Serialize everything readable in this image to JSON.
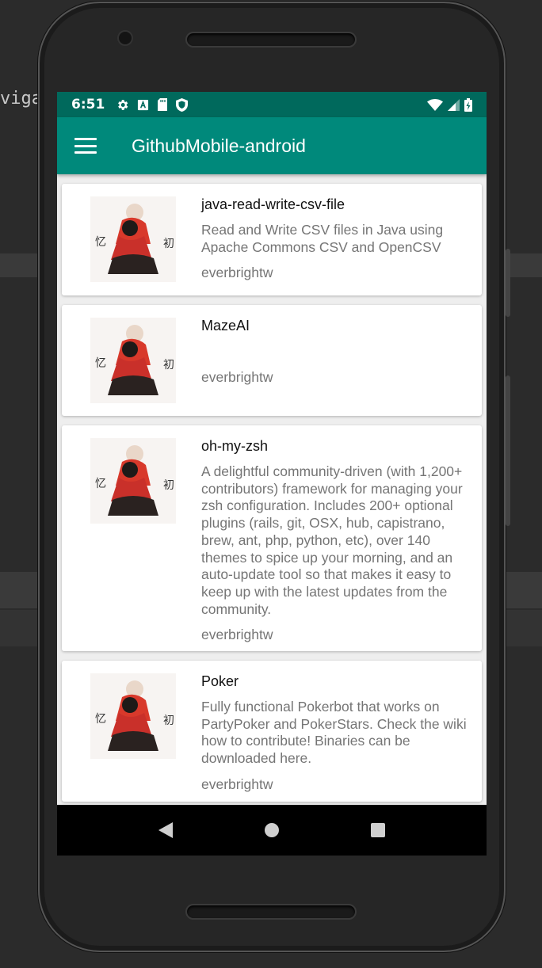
{
  "background": {
    "ide_text": "viga"
  },
  "status_bar": {
    "time": "6:51",
    "icons_left": [
      "settings-icon",
      "a-icon",
      "sd-card-icon",
      "shield-icon"
    ],
    "icons_right": [
      "wifi-icon",
      "signal-icon",
      "battery-charging-icon"
    ],
    "color": "#00695c"
  },
  "app_bar": {
    "title": "GithubMobile-android",
    "menu_icon": "hamburger-menu-icon",
    "color": "#00897b"
  },
  "repos": [
    {
      "name": "java-read-write-csv-file",
      "description": "Read and Write CSV files in Java using Apache Commons CSV and OpenCSV",
      "owner": "everbrightw"
    },
    {
      "name": "MazeAI",
      "description": "",
      "owner": "everbrightw"
    },
    {
      "name": "oh-my-zsh",
      "description": "A delightful community-driven (with 1,200+ contributors) framework for managing your zsh configuration. Includes 200+ optional plugins (rails, git, OSX, hub, capistrano, brew, ant, php, python, etc), over 140 themes to spice up your morning, and an auto-update tool so that makes it easy to keep up with the latest updates from the community.",
      "owner": "everbrightw"
    },
    {
      "name": "Poker",
      "description": "Fully functional Pokerbot that works on PartyPoker and PokerStars. Check the wiki how to contribute! Binaries can be downloaded here.",
      "owner": "everbrightw"
    }
  ],
  "nav_bar": {
    "buttons": [
      "back-icon",
      "home-icon",
      "recents-icon"
    ]
  }
}
